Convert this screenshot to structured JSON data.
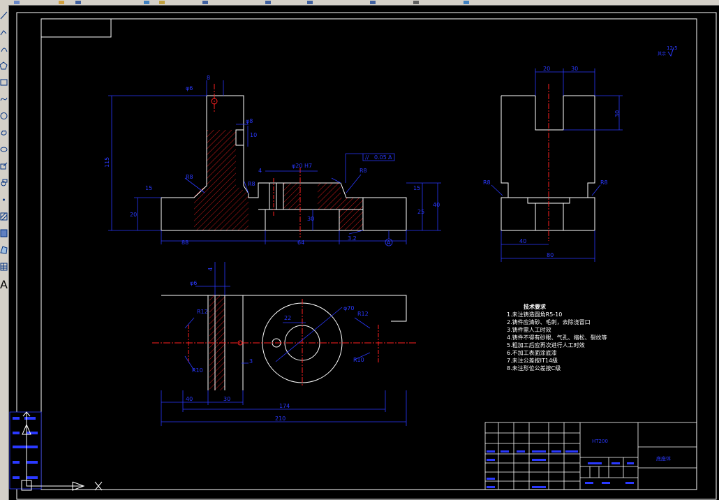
{
  "toolbar_left_items": [
    "line-tool",
    "polyline-tool",
    "arc-tool",
    "polygon-tool",
    "rectangle-tool",
    "spline-tool",
    "circle-tool",
    "revcloud-tool",
    "ellipse-tool",
    "insert-block-tool",
    "make-block-tool",
    "point-tool",
    "hatch-tool",
    "gradient-tool",
    "region-tool",
    "table-tool",
    "text-tool"
  ],
  "text_tool_glyph": "A",
  "colors": {
    "background": "#000000",
    "outline": "#ffffff",
    "dimension": "#2a39ff",
    "centerline": "#ff2020",
    "hatch": "#ff2020",
    "titleblock": "#0000ff"
  },
  "front_view": {
    "dims": {
      "overall_height": "115",
      "overall_width_left": "88",
      "overall_width_right": "64",
      "hole_dia": "φ6",
      "top_offset": "8",
      "counterbore_depth": "φ8",
      "slot_depth": "10",
      "right_height": "40",
      "right_step": "15",
      "right_small": "25",
      "left_base": "20",
      "left_step": "15",
      "groove": "30",
      "radius_left": "R8",
      "radius_mid": "R8",
      "boss_dia": "φ20 H7",
      "radius_right": "R8",
      "tol_small": "4",
      "surface": "3.2",
      "flatness_box": [
        "//",
        "0.05",
        "A"
      ],
      "datum": "A"
    }
  },
  "side_view": {
    "dims": {
      "top_a": "20",
      "top_b": "30",
      "slot_height": "30",
      "radius_left": "R8",
      "radius_right": "R8",
      "bottom_a": "40",
      "bottom_total": "80"
    }
  },
  "top_view": {
    "dims": {
      "top_small": "4",
      "top_hole": "φ6",
      "radius_top_left": "R12",
      "radius_bottom_left": "R10",
      "dia_inner": "22",
      "dia_outer": "φ70",
      "radius_top_right": "R12",
      "radius_bottom_right": "R10",
      "small": "3",
      "bot_40": "40",
      "bot_30": "30",
      "bot_174": "174",
      "bot_210": "210"
    }
  },
  "roughness_corner": "12.5",
  "tech_requirements": {
    "title": "技术要求",
    "items": [
      "1.未注铸造圆角R5-10",
      "2.铸件应清砂、毛刺，去除浇冒口",
      "3.铸件需人工时效",
      "4.铸件不得有砂眼、气孔、缩松、裂纹等",
      "5.粗加工后应再次进行人工时效",
      "6.不加工表面涂底漆",
      "7.未注公差按IT14级",
      "8.未注形位公差按C级"
    ]
  },
  "title_block": {
    "material": "HT200",
    "part_name": "底座体"
  }
}
